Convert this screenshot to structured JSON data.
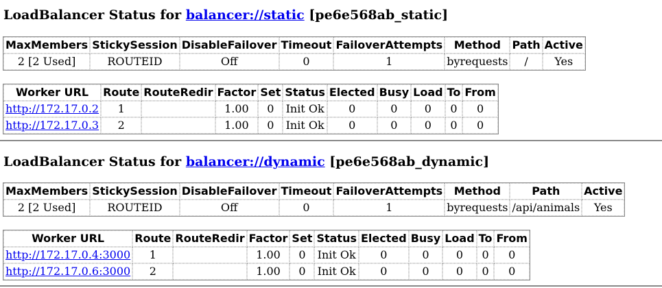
{
  "balancers": [
    {
      "title_prefix": "LoadBalancer Status for",
      "link": "balancer://static",
      "suffix": "[pe6e568ab_static]",
      "summary_headers": [
        "MaxMembers",
        "StickySession",
        "DisableFailover",
        "Timeout",
        "FailoverAttempts",
        "Method",
        "Path",
        "Active"
      ],
      "summary_row": [
        "2 [2 Used]",
        "ROUTEID",
        "Off",
        "0",
        "1",
        "byrequests",
        "/",
        "Yes"
      ],
      "worker_headers": [
        "Worker URL",
        "Route",
        "RouteRedir",
        "Factor",
        "Set",
        "Status",
        "Elected",
        "Busy",
        "Load",
        "To",
        "From"
      ],
      "workers": [
        [
          "http://172.17.0.2",
          "1",
          "",
          "1.00",
          "0",
          "Init Ok",
          "0",
          "0",
          "0",
          "0",
          "0"
        ],
        [
          "http://172.17.0.3",
          "2",
          "",
          "1.00",
          "0",
          "Init Ok",
          "0",
          "0",
          "0",
          "0",
          "0"
        ]
      ]
    },
    {
      "title_prefix": "LoadBalancer Status for",
      "link": "balancer://dynamic",
      "suffix": "[pe6e568ab_dynamic]",
      "summary_headers": [
        "MaxMembers",
        "StickySession",
        "DisableFailover",
        "Timeout",
        "FailoverAttempts",
        "Method",
        "Path",
        "Active"
      ],
      "summary_row": [
        "2 [2 Used]",
        "ROUTEID",
        "Off",
        "0",
        "1",
        "byrequests",
        "/api/animals",
        "Yes"
      ],
      "worker_headers": [
        "Worker URL",
        "Route",
        "RouteRedir",
        "Factor",
        "Set",
        "Status",
        "Elected",
        "Busy",
        "Load",
        "To",
        "From"
      ],
      "workers": [
        [
          "http://172.17.0.4:3000",
          "1",
          "",
          "1.00",
          "0",
          "Init Ok",
          "0",
          "0",
          "0",
          "0",
          "0"
        ],
        [
          "http://172.17.0.6:3000",
          "2",
          "",
          "1.00",
          "0",
          "Init Ok",
          "0",
          "0",
          "0",
          "0",
          "0"
        ]
      ]
    }
  ]
}
